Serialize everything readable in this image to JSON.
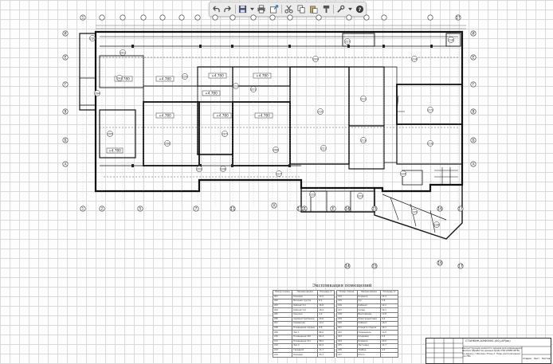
{
  "toolbar": {
    "buttons": [
      {
        "name": "undo-button",
        "icon": "undo-icon"
      },
      {
        "name": "redo-button",
        "icon": "redo-icon"
      },
      {
        "name": "save-button",
        "icon": "save-icon"
      },
      {
        "name": "save-dropdown-button",
        "icon": "chevron-down-icon"
      },
      {
        "name": "print-button",
        "icon": "print-icon"
      },
      {
        "name": "publish-button",
        "icon": "publish-icon"
      },
      {
        "name": "cut-button",
        "icon": "scissors-icon"
      },
      {
        "name": "copy-button",
        "icon": "copy-icon"
      },
      {
        "name": "paste-button",
        "icon": "paste-icon"
      },
      {
        "name": "match-properties-button",
        "icon": "paintbrush-icon"
      },
      {
        "name": "settings-button",
        "icon": "wrench-icon"
      },
      {
        "name": "settings-dropdown-button",
        "icon": "chevron-down-icon"
      },
      {
        "name": "help-button",
        "icon": "help-icon"
      }
    ]
  },
  "axes": {
    "letters": [
      "И",
      "Е",
      "Г",
      "В",
      "Б",
      "А"
    ],
    "numbers_top": [
      "1",
      "",
      "",
      "",
      "",
      "",
      "",
      "",
      "",
      "",
      "",
      "",
      "",
      "",
      "",
      "",
      "",
      "17"
    ],
    "numbers_bottom": [
      "1",
      "2",
      "5",
      "7",
      "11",
      "13",
      "14",
      "15",
      "16",
      "17"
    ],
    "letters_bottom": [
      "А",
      "Д",
      "Е"
    ]
  },
  "plan": {
    "levels": [
      "+4.780",
      "+4.780",
      "+4.780",
      "+4.780",
      "+4.780",
      "+4.780",
      "+4.780",
      "+4.780"
    ],
    "rooms": [
      "201",
      "203",
      "204",
      "205",
      "206",
      "207",
      "208",
      "209",
      "210",
      "211",
      "212",
      "213",
      "214",
      "215",
      "216",
      "217",
      "218",
      "219",
      "220",
      "221",
      "222",
      "223",
      "224",
      "225",
      "226",
      "227",
      "228",
      "229",
      "230"
    ]
  },
  "legend": {
    "title": "Экспликация помещений",
    "headers": [
      "Номер помещ.",
      "Наименование",
      "Площадь м²",
      "Номер помещ.",
      "Наименование",
      "Площадь м²"
    ],
    "rows": [
      [
        "201",
        "Коридор",
        "12,5",
        "214",
        "Коридор",
        "22,4"
      ],
      [
        "202",
        "Входная группа",
        "8,1",
        "215",
        "С/у",
        "5,6"
      ],
      [
        "203",
        "Кабинет 01",
        "16,8",
        "216",
        "Кабинет",
        "14,2"
      ],
      [
        "204",
        "Кабинет 02",
        "18,4",
        "217",
        "Склад",
        "30,1"
      ],
      [
        "205",
        "Санузел",
        "4,2",
        "218",
        "Венткамера",
        "12,8"
      ],
      [
        "206",
        "Административное",
        "24,6",
        "219",
        "Электрощитовая",
        "9,4"
      ],
      [
        "207",
        "Серверная",
        "10,2",
        "220",
        "Кабинет",
        "18,3"
      ],
      [
        "208",
        "Помещение охраны",
        "8,8",
        "221",
        "Комната отдыха",
        "16,1"
      ],
      [
        "209",
        "Зал 1",
        "86,0",
        "222",
        "Помещение",
        "12,0"
      ],
      [
        "210",
        "Помещение 210",
        "64,3",
        "223",
        "Кладовая",
        "6,5"
      ],
      [
        "211",
        "Помещение 211",
        "58,2",
        "224",
        "Коридор",
        "20,0"
      ],
      [
        "212",
        "Зал 2",
        "92,4",
        "225",
        "Лестница",
        "14,7"
      ],
      [
        "213",
        "Гардероб",
        "11,7",
        "226",
        "Тамбур",
        "4,3"
      ],
      [
        "214",
        "Коридор",
        "33,1",
        "227",
        "Итого",
        "—"
      ]
    ]
  },
  "stamp": {
    "title": "СТАНКИН-АЭФ0000-(00)-АР(ок)",
    "subtitle": "Реконструкция нежилого здания для размещения Центра обработки данных ЦОД «НАГАНИЯ ЖТВ» по адресу г.Москва; Этаж 2. План расположения +4,780",
    "cells": [
      "Стадия",
      "Лист",
      "Листов"
    ]
  }
}
